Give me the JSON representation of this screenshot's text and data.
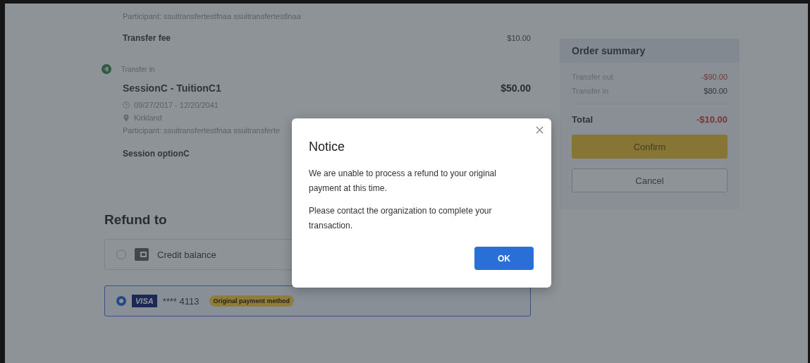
{
  "details": {
    "participant_top": "Participant: ssuitransfertestfnaa ssuitransfertestlnaa",
    "fee": {
      "label": "Transfer fee",
      "amount": "$10.00"
    },
    "transfer_in": {
      "label": "Transfer in",
      "title": "SessionC - TuitionC1",
      "amount": "$50.00",
      "dates": "09/27/2017 - 12/20/2041",
      "location": "Kirkland",
      "participant": "Participant: ssuitransfertestfnaa ssuitransferte",
      "option": "Session optionC"
    }
  },
  "refund": {
    "title": "Refund to",
    "options": [
      {
        "kind": "credit",
        "label": "Credit balance",
        "selected": false
      },
      {
        "kind": "card",
        "brand": "VISA",
        "number": "**** 4113",
        "badge": "Original payment method",
        "selected": true
      }
    ]
  },
  "order_summary": {
    "title": "Order summary",
    "lines": [
      {
        "label": "Transfer out",
        "amount": "-$90.00",
        "negative": true
      },
      {
        "label": "Transfer in",
        "amount": "$80.00",
        "negative": false
      }
    ],
    "total": {
      "label": "Total",
      "amount": "-$10.00",
      "negative": true
    },
    "confirm": "Confirm",
    "cancel": "Cancel"
  },
  "dialog": {
    "title": "Notice",
    "paragraphs": [
      "We are unable to process a refund to your original payment at this time.",
      "Please contact the organization to complete your transaction."
    ],
    "ok": "OK"
  }
}
